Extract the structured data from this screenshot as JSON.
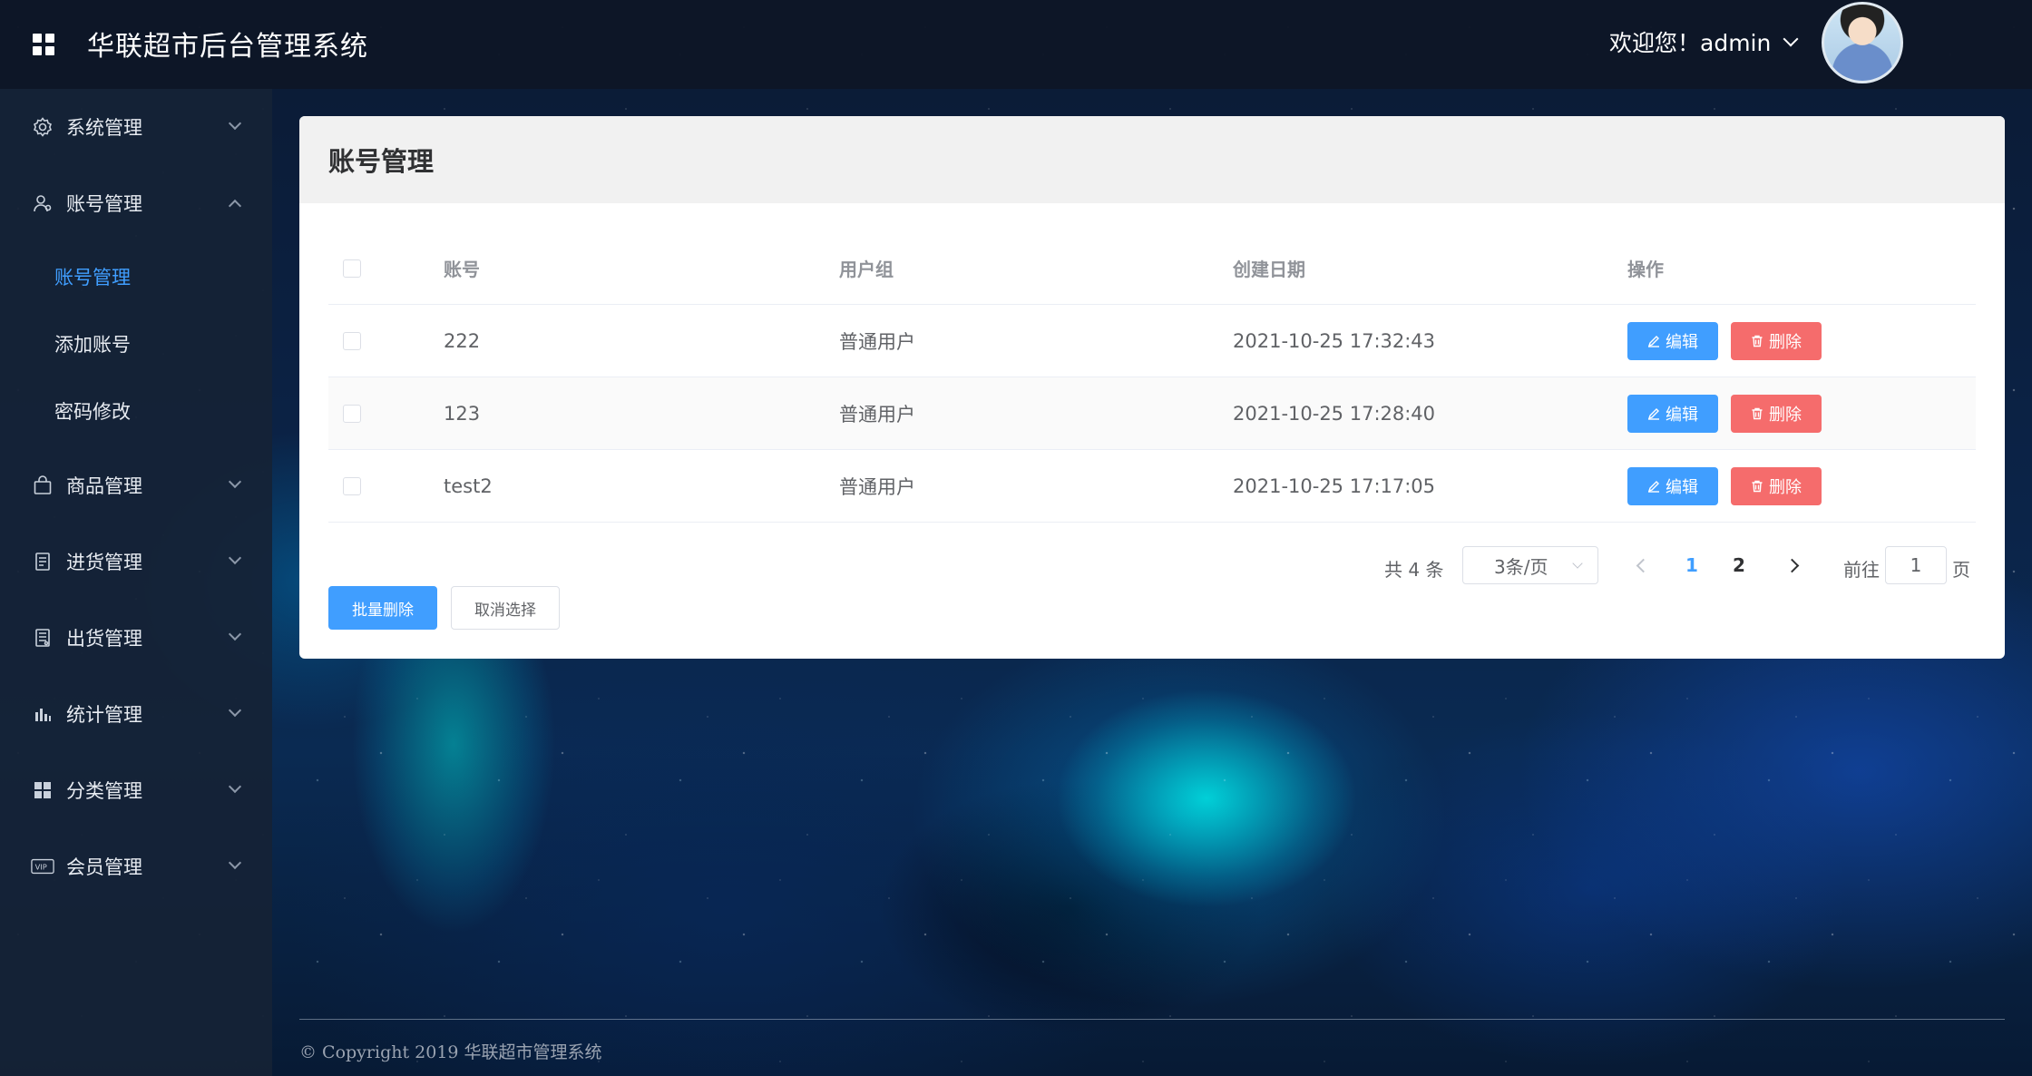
{
  "header": {
    "title": "华联超市后台管理系统",
    "welcome": "欢迎您！admin"
  },
  "sidebar": {
    "menus": [
      {
        "label": "系统管理",
        "icon": "gear-icon",
        "expanded": false
      },
      {
        "label": "账号管理",
        "icon": "user-icon",
        "expanded": true
      },
      {
        "label": "商品管理",
        "icon": "shopping-bag-icon",
        "expanded": false
      },
      {
        "label": "进货管理",
        "icon": "document-icon",
        "expanded": false
      },
      {
        "label": "出货管理",
        "icon": "document-list-icon",
        "expanded": false
      },
      {
        "label": "统计管理",
        "icon": "bar-chart-icon",
        "expanded": false
      },
      {
        "label": "分类管理",
        "icon": "grid-icon",
        "expanded": false
      },
      {
        "label": "会员管理",
        "icon": "vip-icon",
        "expanded": false
      }
    ],
    "submenu": [
      {
        "label": "账号管理",
        "active": true
      },
      {
        "label": "添加账号",
        "active": false
      },
      {
        "label": "密码修改",
        "active": false
      }
    ]
  },
  "card": {
    "title": "账号管理"
  },
  "table": {
    "columns": [
      "账号",
      "用户组",
      "创建日期",
      "操作"
    ],
    "rows": [
      {
        "account": "222",
        "group": "普通用户",
        "date": "2021-10-25 17:32:43"
      },
      {
        "account": "123",
        "group": "普通用户",
        "date": "2021-10-25 17:28:40"
      },
      {
        "account": "test2",
        "group": "普通用户",
        "date": "2021-10-25 17:17:05"
      }
    ],
    "edit_label": "编辑",
    "delete_label": "删除"
  },
  "pagination": {
    "total": "共 4 条",
    "page_size": "3条/页",
    "pages": [
      "1",
      "2"
    ],
    "current": "1",
    "goto_label": "前往",
    "goto_value": "1",
    "page_suffix": "页"
  },
  "actions": {
    "bulk_delete": "批量删除",
    "cancel_select": "取消选择"
  },
  "footer": {
    "copyright": "© Copyright 2019 华联超市管理系统"
  },
  "colors": {
    "primary": "#409eff",
    "danger": "#f56c6c",
    "header_bg": "#0e1626",
    "sidebar_bg": "#162236"
  }
}
